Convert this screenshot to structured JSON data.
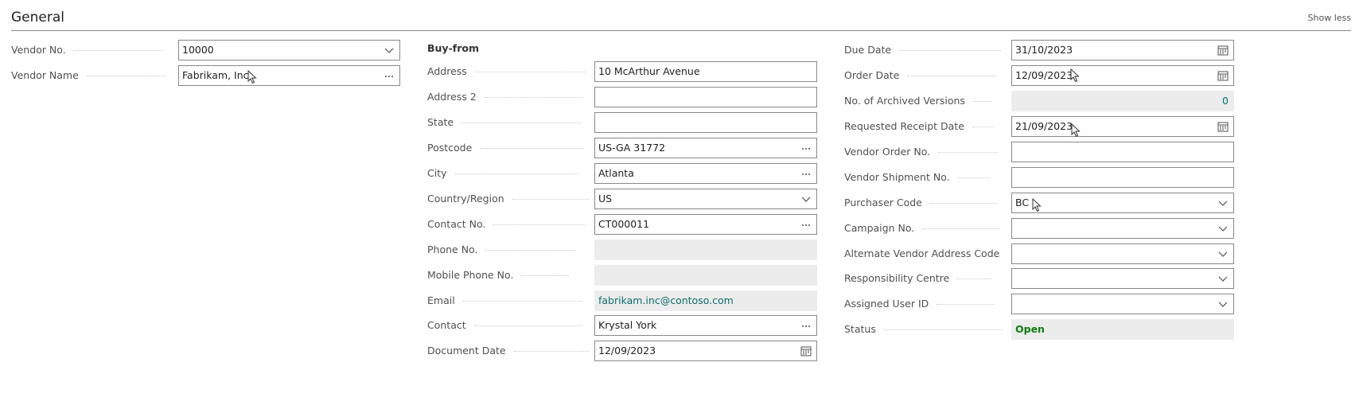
{
  "header": {
    "title": "General",
    "show_less": "Show less"
  },
  "col1": {
    "vendor_no": {
      "label": "Vendor No.",
      "value": "10000"
    },
    "vendor_name": {
      "label": "Vendor Name",
      "value": "Fabrikam, Inc."
    }
  },
  "col2": {
    "section": "Buy-from",
    "address": {
      "label": "Address",
      "value": "10 McArthur Avenue"
    },
    "address2": {
      "label": "Address 2",
      "value": ""
    },
    "state": {
      "label": "State",
      "value": ""
    },
    "postcode": {
      "label": "Postcode",
      "value": "US-GA 31772"
    },
    "city": {
      "label": "City",
      "value": "Atlanta"
    },
    "country": {
      "label": "Country/Region",
      "value": "US"
    },
    "contact_no": {
      "label": "Contact No.",
      "value": "CT000011"
    },
    "phone": {
      "label": "Phone No.",
      "value": ""
    },
    "mobile": {
      "label": "Mobile Phone No.",
      "value": ""
    },
    "email": {
      "label": "Email",
      "value": "fabrikam.inc@contoso.com"
    },
    "contact": {
      "label": "Contact",
      "value": "Krystal York"
    },
    "document_date": {
      "label": "Document Date",
      "value": "12/09/2023"
    }
  },
  "col3": {
    "due_date": {
      "label": "Due Date",
      "value": "31/10/2023"
    },
    "order_date": {
      "label": "Order Date",
      "value": "12/09/2023"
    },
    "archived": {
      "label": "No. of Archived Versions",
      "value": "0"
    },
    "requested_receipt": {
      "label": "Requested Receipt Date",
      "value": "21/09/2023"
    },
    "vendor_order_no": {
      "label": "Vendor Order No.",
      "value": ""
    },
    "vendor_shipment_no": {
      "label": "Vendor Shipment No.",
      "value": ""
    },
    "purchaser_code": {
      "label": "Purchaser Code",
      "value": "BC"
    },
    "campaign_no": {
      "label": "Campaign No.",
      "value": ""
    },
    "alt_vendor_address": {
      "label": "Alternate Vendor Address Code",
      "value": ""
    },
    "responsibility_centre": {
      "label": "Responsibility Centre",
      "value": ""
    },
    "assigned_user": {
      "label": "Assigned User ID",
      "value": ""
    },
    "status": {
      "label": "Status",
      "value": "Open"
    }
  },
  "icons": {
    "dropdown": "chevron-down-icon",
    "lookup": "ellipsis-icon",
    "calendar": "calendar-icon"
  },
  "colors": {
    "border": "#8a8886",
    "readonly_bg": "#ececec",
    "status_green": "#107c10",
    "link": "#0f6e6e"
  }
}
